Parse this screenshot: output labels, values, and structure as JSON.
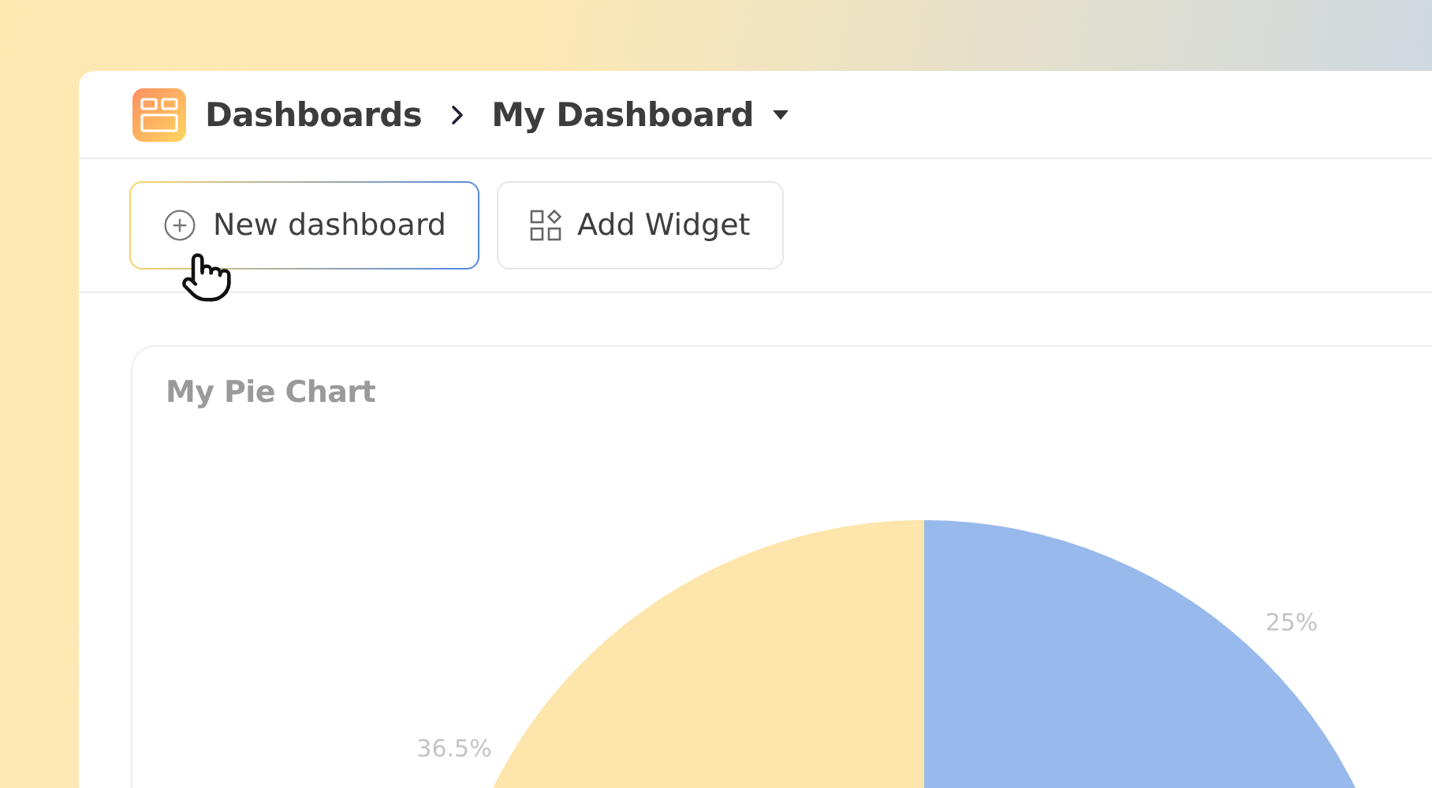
{
  "breadcrumb": [
    {
      "label": "Dashboards"
    },
    {
      "label": "My Dashboard"
    }
  ],
  "toolbar": {
    "buttons": [
      {
        "label": "New dashboard",
        "kind": "new",
        "selected": true
      },
      {
        "label": "Add Widget",
        "kind": "widget",
        "selected": false
      }
    ]
  },
  "card": {
    "title": "My Pie Chart",
    "chart_data": {
      "type": "pie",
      "values": [
        25,
        36.5
      ],
      "colors": [
        "#98b9ec",
        "#fde5ab"
      ],
      "data_labels": true,
      "value_labels": [
        "25%",
        "36.5%"
      ]
    }
  }
}
